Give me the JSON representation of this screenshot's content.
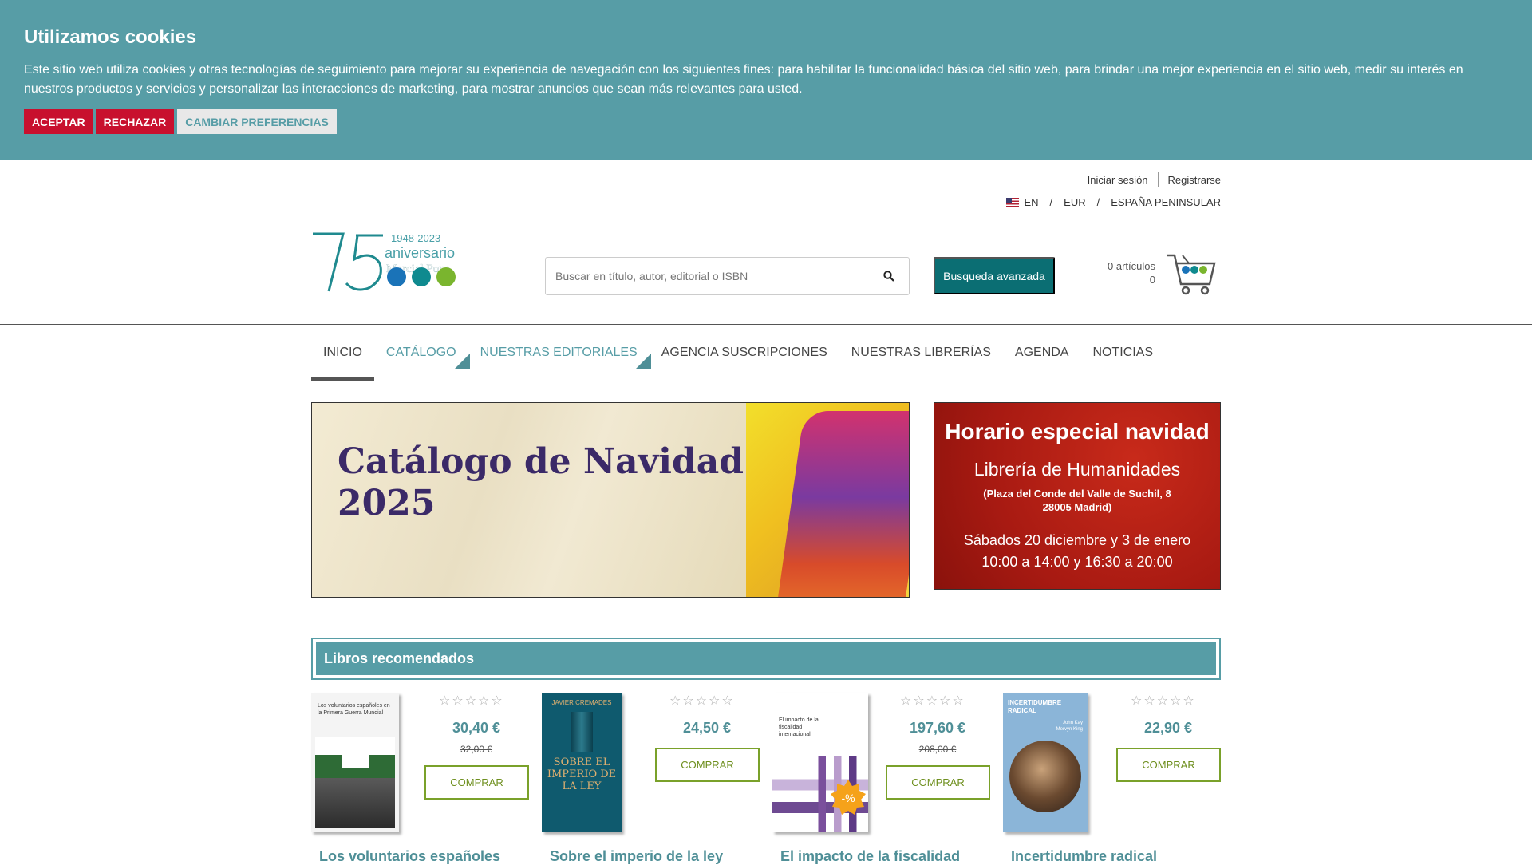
{
  "cookie": {
    "title": "Utilizamos cookies",
    "text": "Este sitio web utiliza cookies y otras tecnologías de seguimiento para mejorar su experiencia de navegación con los siguientes fines: para habilitar la funcionalidad básica del sitio web, para brindar una mejor experiencia en el sitio web, medir su interés en nuestros productos y servicios y personalizar las interacciones de marketing, para mostrar anuncios que sean más relevantes para usted.",
    "accept": "ACEPTAR",
    "reject": "RECHAZAR",
    "prefs": "CAMBIAR PREFERENCIAS"
  },
  "util": {
    "login": "Iniciar sesión",
    "register": "Registrarse",
    "lang": "EN",
    "currency": "EUR",
    "region": "ESPAÑA PENINSULAR",
    "slash": "/"
  },
  "logo": {
    "years": "1948-2023",
    "word": "aniversario",
    "brand": "Marcial Pons"
  },
  "search": {
    "placeholder": "Buscar en título, autor, editorial o ISBN",
    "advanced": "Busqueda avanzada"
  },
  "cart": {
    "items": "0 artículos",
    "total": "0"
  },
  "nav": [
    {
      "label": "INICIO"
    },
    {
      "label": "CATÁLOGO"
    },
    {
      "label": "NUESTRAS EDITORIALES"
    },
    {
      "label": "AGENCIA SUSCRIPCIONES"
    },
    {
      "label": "NUESTRAS LIBRERÍAS"
    },
    {
      "label": "AGENDA"
    },
    {
      "label": "NOTICIAS"
    }
  ],
  "banner1": {
    "line1": "Catálogo de Navidad",
    "line2": "2025"
  },
  "banner2": {
    "heading": "Horario especial navidad",
    "store": "Librería de Humanidades",
    "address1": "(Plaza del Conde del Valle de Suchil, 8",
    "address2": "28005 Madrid)",
    "dates": "Sábados 20 diciembre y 3 de enero",
    "hours": "10:00 a 14:00 y 16:30 a 20:00"
  },
  "section": {
    "title": "Libros recomendados"
  },
  "stars": "☆☆☆☆☆",
  "products": [
    {
      "title": "Los voluntarios españoles",
      "price": "30,40 €",
      "old_price": "32,00 €",
      "buy": "COMPRAR",
      "cover_text": "Los voluntarios españoles en la Primera Guerra Mundial"
    },
    {
      "title": "Sobre el imperio de la ley",
      "price": "24,50 €",
      "old_price": "",
      "buy": "COMPRAR",
      "cover_text": "JAVIER CREMADES",
      "cover_title": "SOBRE EL IMPERIO DE LA LEY"
    },
    {
      "title": "El impacto de la fiscalidad",
      "price": "197,60 €",
      "old_price": "208,00 €",
      "buy": "COMPRAR",
      "cover_text": "El impacto de la fiscalidad internacional",
      "badge": "-%"
    },
    {
      "title": "Incertidumbre radical",
      "price": "22,90 €",
      "old_price": "",
      "buy": "COMPRAR",
      "cover_text": "INCERTIDUMBRE RADICAL",
      "cover_authors": "John Kay Mervyn King"
    }
  ],
  "colors": {
    "teal": "#579da6",
    "dark_teal": "#0b6e73",
    "red": "#c8102e",
    "green": "#7aa12a"
  }
}
